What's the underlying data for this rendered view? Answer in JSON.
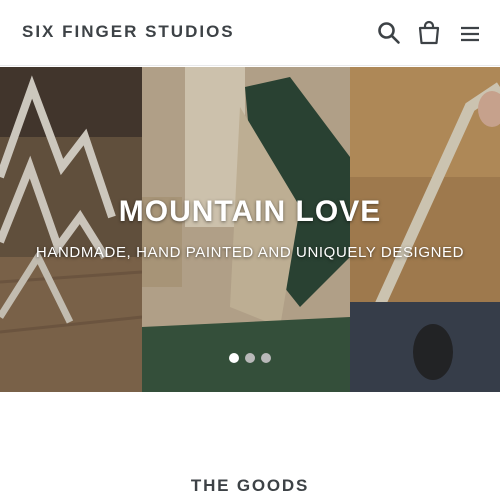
{
  "header": {
    "logo": "SIX FINGER STUDIOS",
    "icons": {
      "search": "search-icon",
      "cart": "cart-icon",
      "menu": "menu-icon"
    }
  },
  "hero": {
    "title": "MOUNTAIN LOVE",
    "subtitle": "HANDMADE, HAND PAINTED AND UNIQUELY DESIGNED",
    "slide_count": 3,
    "active_slide": 1
  },
  "section": {
    "title": "THE GOODS"
  },
  "colors": {
    "text": "#3d4246",
    "background": "#ffffff",
    "dot_active": "#ffffff",
    "dot_inactive": "#b9b9b9"
  }
}
